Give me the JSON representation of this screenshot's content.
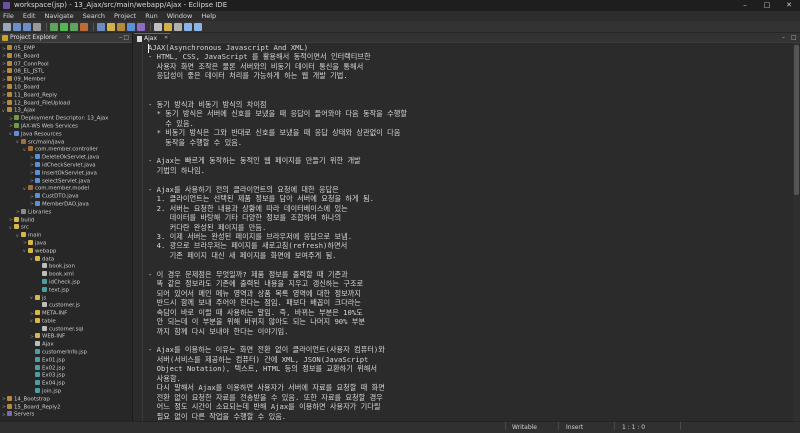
{
  "window": {
    "title": "workspace(jsp) - 13_Ajax/src/main/webapp/Ajax - Eclipse IDE",
    "minimize": "–",
    "maximize": "□",
    "close": "✕"
  },
  "menu": [
    "File",
    "Edit",
    "Navigate",
    "Search",
    "Project",
    "Run",
    "Window",
    "Help"
  ],
  "toolbar": {
    "icons": [
      "new-icon",
      "save-icon",
      "save-all-icon",
      "print-icon",
      "debug-icon",
      "run-icon",
      "run-config-icon",
      "external-tools-icon",
      "server-icon",
      "new-java-project-icon",
      "new-package-icon",
      "new-class-icon",
      "open-type-icon",
      "search-icon",
      "back-icon",
      "forward-icon"
    ],
    "colors": [
      "#9aa7b8",
      "#6c8fc7",
      "#6c8fc7",
      "#9a9a9a",
      "#5fa35f",
      "#4fb84f",
      "#5fa35f",
      "#c06a3a",
      "#6b8cc0",
      "#d2b14a",
      "#b58a3a",
      "#5b8fd6",
      "#8e6bc0",
      "#c0c0c0",
      "#d2b14a",
      "#b0b0b0",
      "#8ab4e8",
      "#8ab4e8"
    ]
  },
  "explorer": {
    "title": "Project Explorer",
    "close": "✕",
    "minimize": "–",
    "maximize": "□",
    "items": [
      {
        "label": "05_EMP",
        "depth": 1,
        "icon": "project",
        "arrow": ">"
      },
      {
        "label": "06_Board",
        "depth": 1,
        "icon": "project",
        "arrow": ">"
      },
      {
        "label": "07_ConnPool",
        "depth": 1,
        "icon": "project",
        "arrow": ">"
      },
      {
        "label": "08_EL_JSTL",
        "depth": 1,
        "icon": "project",
        "arrow": ">"
      },
      {
        "label": "09_Member",
        "depth": 1,
        "icon": "project",
        "arrow": ">"
      },
      {
        "label": "10_Board",
        "depth": 1,
        "icon": "project",
        "arrow": ">"
      },
      {
        "label": "11_Board_Reply",
        "depth": 1,
        "icon": "project",
        "arrow": ">"
      },
      {
        "label": "12_Board_FileUpload",
        "depth": 1,
        "icon": "project",
        "arrow": ">"
      },
      {
        "label": "13_Ajax",
        "depth": 1,
        "icon": "project",
        "arrow": "v"
      },
      {
        "label": "Deployment Descriptor: 13_Ajax",
        "depth": 2,
        "icon": "web",
        "arrow": ">"
      },
      {
        "label": "JAX-WS Web Services",
        "depth": 2,
        "icon": "web",
        "arrow": ">"
      },
      {
        "label": "Java Resources",
        "depth": 2,
        "icon": "java",
        "arrow": "v"
      },
      {
        "label": "src/main/java",
        "depth": 3,
        "icon": "package",
        "arrow": "v"
      },
      {
        "label": "com.member.controller",
        "depth": 4,
        "icon": "package",
        "arrow": "v"
      },
      {
        "label": "DeleteOkServlet.java",
        "depth": 5,
        "icon": "java",
        "arrow": ">"
      },
      {
        "label": "idCheckServlet.java",
        "depth": 5,
        "icon": "java",
        "arrow": ">"
      },
      {
        "label": "InsertOkServlet.java",
        "depth": 5,
        "icon": "java",
        "arrow": ">"
      },
      {
        "label": "selectServlet.java",
        "depth": 5,
        "icon": "java",
        "arrow": ">"
      },
      {
        "label": "com.member.model",
        "depth": 4,
        "icon": "package",
        "arrow": "v"
      },
      {
        "label": "CustDTO.java",
        "depth": 5,
        "icon": "java",
        "arrow": ">"
      },
      {
        "label": "MemberDAO.java",
        "depth": 5,
        "icon": "java",
        "arrow": ">"
      },
      {
        "label": "Libraries",
        "depth": 3,
        "icon": "lib",
        "arrow": ">"
      },
      {
        "label": "build",
        "depth": 2,
        "icon": "folder",
        "arrow": ">"
      },
      {
        "label": "src",
        "depth": 2,
        "icon": "folder",
        "arrow": "v"
      },
      {
        "label": "main",
        "depth": 3,
        "icon": "folder",
        "arrow": "v"
      },
      {
        "label": "java",
        "depth": 4,
        "icon": "folder",
        "arrow": ">"
      },
      {
        "label": "webapp",
        "depth": 4,
        "icon": "folder",
        "arrow": "v"
      },
      {
        "label": "data",
        "depth": 5,
        "icon": "folder",
        "arrow": "v"
      },
      {
        "label": "book.json",
        "depth": 6,
        "icon": "file",
        "arrow": ""
      },
      {
        "label": "book.xml",
        "depth": 6,
        "icon": "file",
        "arrow": ""
      },
      {
        "label": "idCheck.jsp",
        "depth": 6,
        "icon": "jsp",
        "arrow": ""
      },
      {
        "label": "text.jsp",
        "depth": 6,
        "icon": "jsp",
        "arrow": ""
      },
      {
        "label": "js",
        "depth": 5,
        "icon": "folder",
        "arrow": "v"
      },
      {
        "label": "customer.js",
        "depth": 6,
        "icon": "file",
        "arrow": ""
      },
      {
        "label": "META-INF",
        "depth": 5,
        "icon": "folder",
        "arrow": ">"
      },
      {
        "label": "table",
        "depth": 5,
        "icon": "folder",
        "arrow": "v"
      },
      {
        "label": "customer.sql",
        "depth": 6,
        "icon": "file",
        "arrow": ""
      },
      {
        "label": "WEB-INF",
        "depth": 5,
        "icon": "folder",
        "arrow": ">"
      },
      {
        "label": "Ajax",
        "depth": 5,
        "icon": "file",
        "arrow": ""
      },
      {
        "label": "customerInfo.jsp",
        "depth": 5,
        "icon": "jsp",
        "arrow": ""
      },
      {
        "label": "Ex01.jsp",
        "depth": 5,
        "icon": "jsp",
        "arrow": ""
      },
      {
        "label": "Ex02.jsp",
        "depth": 5,
        "icon": "jsp",
        "arrow": ""
      },
      {
        "label": "Ex03.jsp",
        "depth": 5,
        "icon": "jsp",
        "arrow": ""
      },
      {
        "label": "Ex04.jsp",
        "depth": 5,
        "icon": "jsp",
        "arrow": ""
      },
      {
        "label": "join.jsp",
        "depth": 5,
        "icon": "jsp",
        "arrow": ""
      },
      {
        "label": "14_Bootstrap",
        "depth": 1,
        "icon": "project",
        "arrow": ">"
      },
      {
        "label": "15_Board_Reply2",
        "depth": 1,
        "icon": "project",
        "arrow": ">"
      },
      {
        "label": "Servers",
        "depth": 1,
        "icon": "server",
        "arrow": ">"
      }
    ]
  },
  "editor": {
    "tab_label": "Ajax",
    "tab_close": "✕",
    "minimize": "–",
    "maximize": "□",
    "lines": [
      "AJAX(Asynchronous Javascript And XML)",
      "- HTML, CSS, JavaScript 를 활용해서 동적이면서 인터랙티브한",
      "  사용자 화면 조작은 물론 서버와의 비동기 데이터 통신을 통해서",
      "  응답성이 좋은 데이터 처리를 가능하게 하는 웹 개발 기법.",
      "",
      "",
      "- 동기 방식과 비동기 방식의 차이점",
      "  * 동기 방식은 서버에 신호를 보냈을 때 응답이 들어와야 다음 동작을 수행할",
      "    수 있음.",
      "  * 비동기 방식은 그와 반대로 신호를 보냈을 때 응답 상태와 상관없이 다음",
      "    동작을 수행할 수 있음.",
      "",
      "- Ajax는 빠르게 동작하는 동적인 웹 페이지를 만들기 위한 개발",
      "  기법의 하나임.",
      "",
      "- Ajax를 사용하기 전의 클라이언트의 요청에 대한 응답은",
      "  1. 클라이언트는 선택된 제품 정보를 담아 서버에 요청을 하게 됨.",
      "  2. 서버는 요청한 내용과 상황에 따라 데이터베이스에 있는",
      "     데이터를 바탕해 기타 다양한 정보를 조합하여 하나의",
      "     커다란 완성된 페이지를 만듬.",
      "  3. 이제 서버는 완성된 페이지를 브라우저에 응답으로 보냄.",
      "  4. 광으로 브라우저는 페이지를 새로고침(refresh)하면서",
      "     기존 페이지 대신 새 페이지를 화면에 보여주게 됨.",
      "",
      "- 이 경우 문제점은 무엇일까? 제품 정보를 출력할 때 기존과",
      "  똑 같은 정보라도 기존에 출력된 내용을 지우고 갱신하는 구조로",
      "  되어 있어서 메인 메뉴 영역과 상품 목록 영역에 대한 정보까지",
      "  반드시 함께 보내 주어야 한다는 점임. 패보다 배꼽이 크다라는",
      "  속담이 바로 이럴 때 사용하는 말임. 즉, 바뀌는 부분은 10%도",
      "  안 되는데 이 부분을 위해 바뀌지 않아도 되는 나머지 90% 부분",
      "  까지 함께 다시 보내야 한다는 이야기임.",
      "",
      "- Ajax를 이용하는 이유는 화면 전환 없이 클라이언트(사용자 컴퓨터)와",
      "  서버(서비스를 제공하는 컴퓨터) 간에 XML, JSON(JavaScript",
      "  Object Notation), 텍스트, HTML 등의 정보를 교환하기 위해서",
      "  사용함.",
      "  다시 말해서 Ajax를 이용하면 사용자가 서버에 자료를 요청할 때 화면",
      "  전환 없이 요청한 자료를 전송받을 수 있음. 또한 자료를 요청할 경우",
      "  어느 정도 시간이 소요되는데 반해 Ajax를 이용하면 사용자가 기다릴",
      "  필요 없이 다른 작업을 수행할 수 있음."
    ]
  },
  "status": {
    "writable": "Writable",
    "insert": "Insert",
    "position": "1 : 1 : 0"
  }
}
